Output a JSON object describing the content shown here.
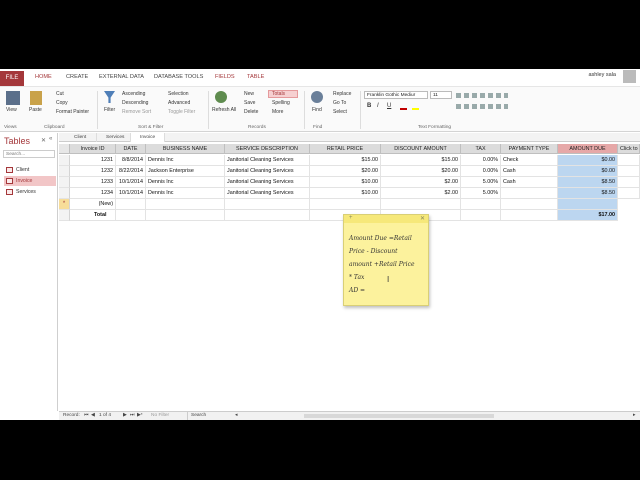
{
  "ribbon_tabs": [
    "FILE",
    "HOME",
    "CREATE",
    "EXTERNAL DATA",
    "DATABASE TOOLS",
    "FIELDS",
    "TABLE"
  ],
  "user": "ashley sala",
  "ribbon": {
    "view": "View",
    "paste": "Paste",
    "cut": "Cut",
    "copy": "Copy",
    "format_painter": "Format Painter",
    "filter": "Filter",
    "ascending": "Ascending",
    "descending": "Descending",
    "remove_sort": "Remove Sort",
    "selection": "Selection",
    "advanced": "Advanced",
    "toggle_filter": "Toggle Filter",
    "refresh_all": "Refresh All",
    "new": "New",
    "save": "Save",
    "delete": "Delete",
    "totals": "Totals",
    "spelling": "Spelling",
    "more": "More",
    "find": "Find",
    "replace": "Replace",
    "go_to": "Go To",
    "select": "Select",
    "font_name": "Franklin Gothic Mediur",
    "font_size": "11",
    "bold": "B",
    "italic": "I",
    "underline": "U",
    "groups": {
      "views": "Views",
      "clipboard": "Clipboard",
      "sort_filter": "Sort & Filter",
      "records": "Records",
      "find": "Find",
      "text_formatting": "Text Formatting"
    }
  },
  "nav": {
    "title": "Tables",
    "search_placeholder": "Search...",
    "items": [
      "Client",
      "Invoice",
      "Services"
    ]
  },
  "object_tabs": [
    "Client",
    "Services",
    "Invoice"
  ],
  "columns": [
    "Invoice ID",
    "DATE",
    "BUSINESS NAME",
    "SERVICE DESCRIPTION",
    "RETAIL PRICE",
    "DISCOUNT AMOUNT",
    "TAX",
    "PAYMENT TYPE",
    "AMOUNT DUE",
    "Click to"
  ],
  "rows": [
    [
      "1231",
      "8/8/2014",
      "Dennis Inc",
      "Janitorial Cleaning Services",
      "$15.00",
      "$15.00",
      "0.00%",
      "Check",
      "$0.00"
    ],
    [
      "1232",
      "8/22/2014",
      "Jackson Enterprise",
      "Janitorial Cleaning Services",
      "$20.00",
      "$20.00",
      "0.00%",
      "Cash",
      "$0.00"
    ],
    [
      "1233",
      "10/1/2014",
      "Dennis Inc",
      "Janitorial Cleaning Services",
      "$10.00",
      "$2.00",
      "5.00%",
      "Cash",
      "$8.50"
    ],
    [
      "1234",
      "10/1/2014",
      "Dennis Inc",
      "Janitorial Cleaning Services",
      "$10.00",
      "$2.00",
      "5.00%",
      "",
      "$8.50"
    ]
  ],
  "new_row_label": "(New)",
  "total_label": "Total",
  "total_amount": "$17.00",
  "note": {
    "lines": [
      "Amount Due =Retail",
      "Price - Discount",
      "amount +Retail Price",
      "* Tax",
      "AD ="
    ]
  },
  "status": {
    "record_label": "Record:",
    "record_pos": "1 of 4",
    "filter": "No Filter",
    "search": "Search"
  },
  "colors": {
    "accent": "#a4373a",
    "selected_column": "#bcd6f0",
    "note": "#fcf29d"
  }
}
